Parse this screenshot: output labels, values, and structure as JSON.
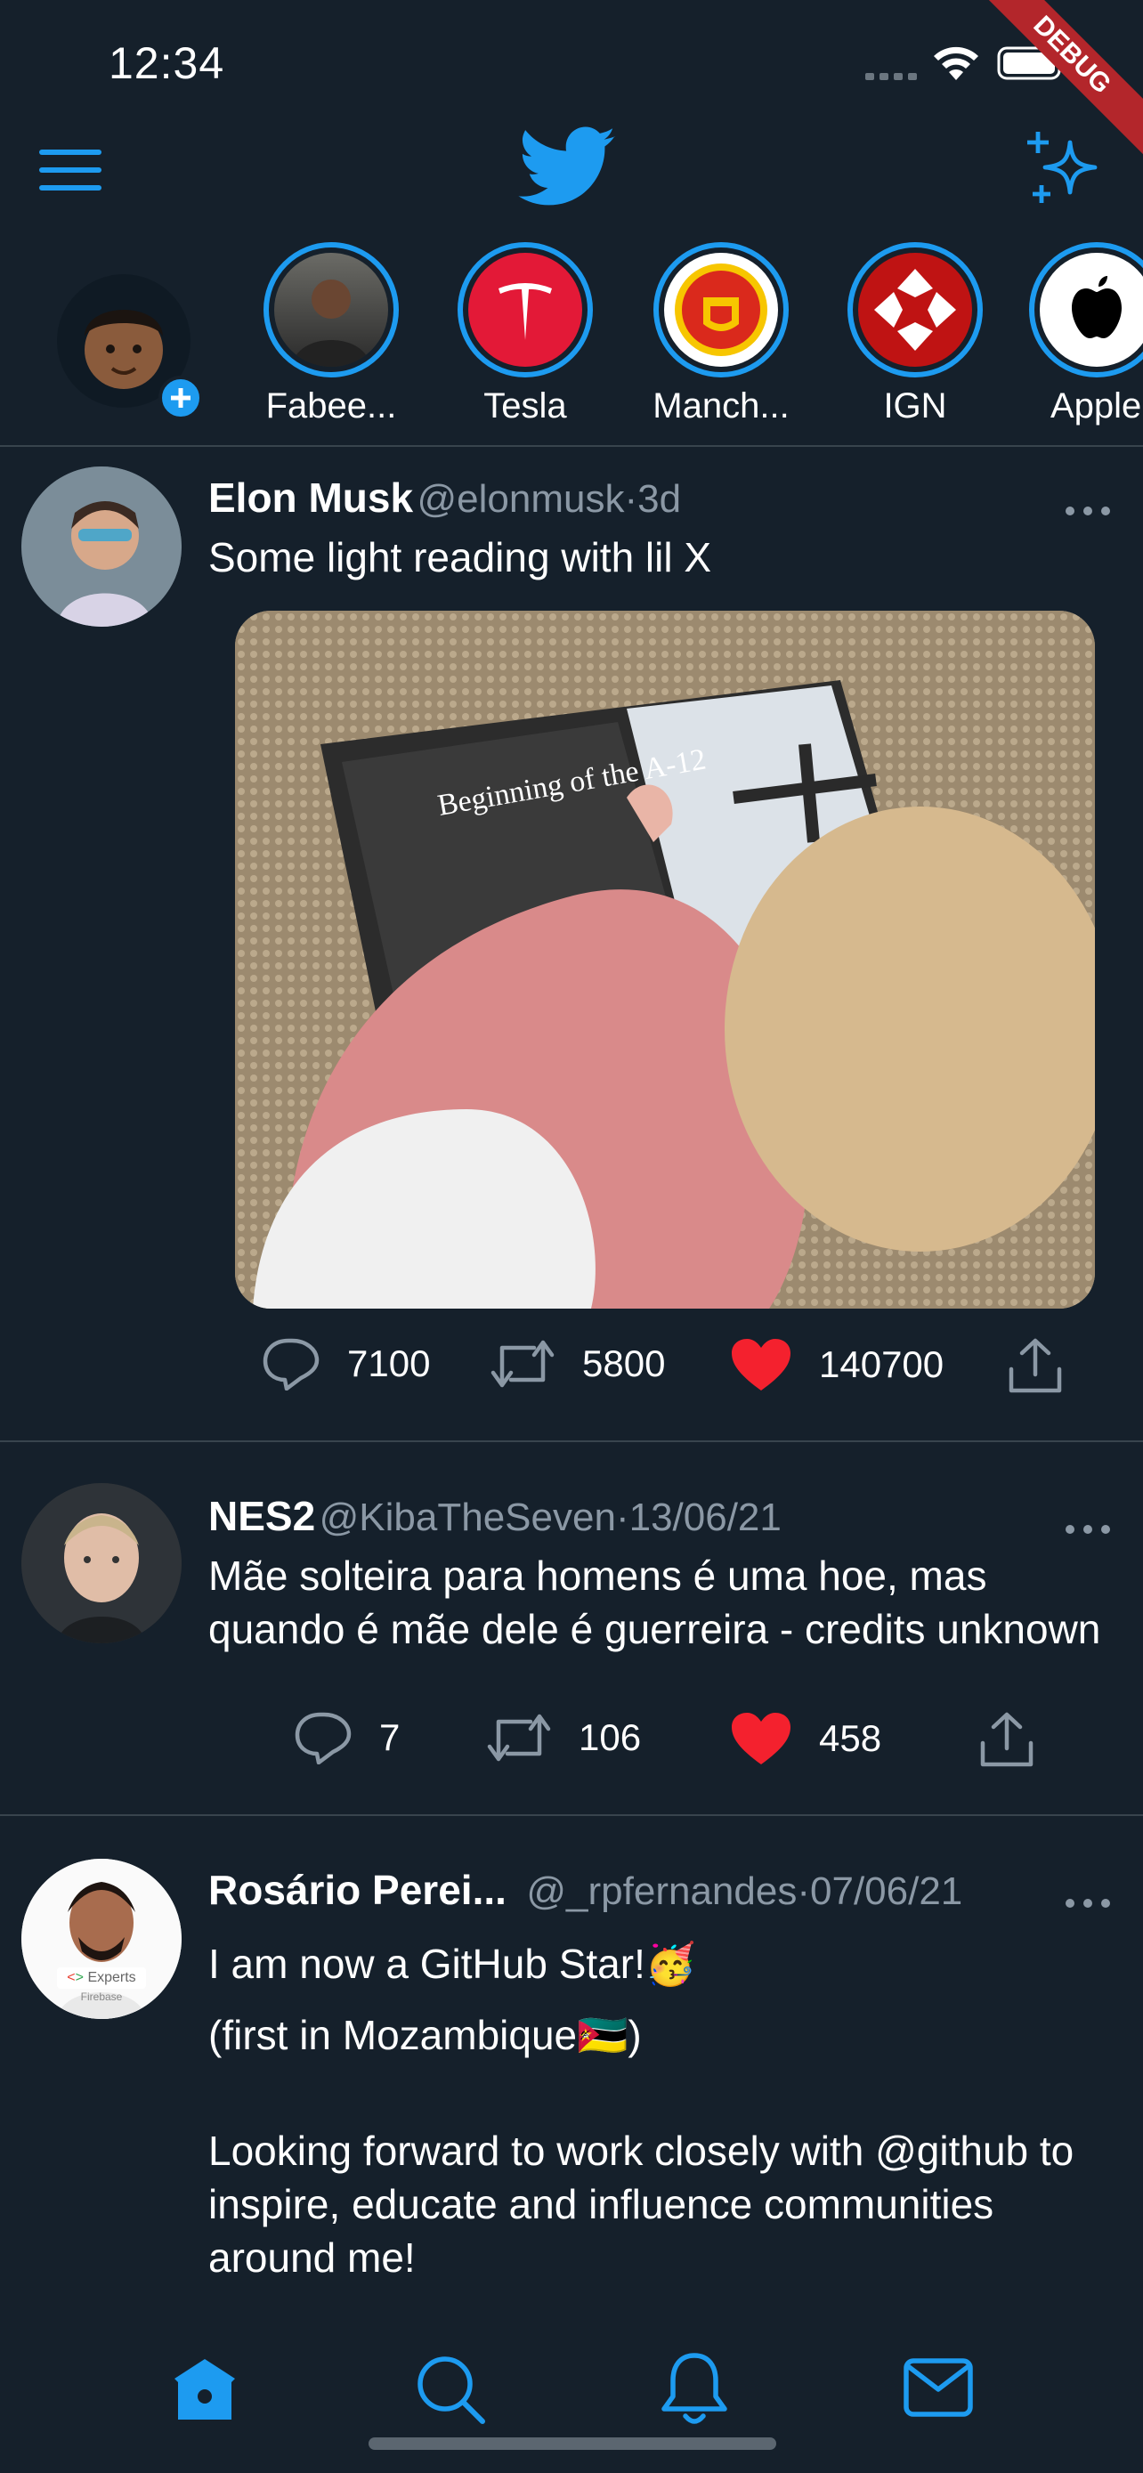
{
  "status_bar": {
    "time": "12:34",
    "debug_label": "DEBUG"
  },
  "colors": {
    "background": "#15202b",
    "accent": "#1d9bf0",
    "like": "#f91880",
    "muted": "#8b98a5",
    "divider": "#38444d"
  },
  "header": {
    "menu_icon": "hamburger-icon",
    "logo_icon": "twitter-bird-icon",
    "sparkle_icon": "sparkle-icon"
  },
  "stories": [
    {
      "label": "Fabee..."
    },
    {
      "label": "Tesla"
    },
    {
      "label": "Manch..."
    },
    {
      "label": "IGN"
    },
    {
      "label": "Apple"
    }
  ],
  "tweets": [
    {
      "name": "Elon Musk",
      "handle": "@elonmusk",
      "sep": "·",
      "time": "3d",
      "text": "Some light reading with lil X",
      "image_text": "Beginning of the A-12",
      "replies": "7100",
      "retweets": "5800",
      "likes": "140700"
    },
    {
      "name": "NES2",
      "handle": "@KibaTheSeven",
      "sep": "·",
      "time": "13/06/21",
      "text": "Mãe solteira para homens é uma hoe, mas quando é mãe dele é guerreira - credits unknown",
      "replies": "7",
      "retweets": "106",
      "likes": "458"
    },
    {
      "name": "Rosário Perei...",
      "handle": "@_rpfernandes",
      "sep": "·",
      "time": "07/06/21",
      "line1": "I am now a GitHub Star!🥳",
      "line2": "(first in Mozambique🇲🇿)",
      "line3": "Looking forward to work closely with @github to inspire, educate and influence communities around me!",
      "avatar_badge": "Experts",
      "avatar_sub": "Firebase"
    }
  ],
  "bottom_nav": [
    {
      "icon": "home-icon"
    },
    {
      "icon": "search-icon"
    },
    {
      "icon": "notifications-icon"
    },
    {
      "icon": "messages-icon"
    }
  ]
}
